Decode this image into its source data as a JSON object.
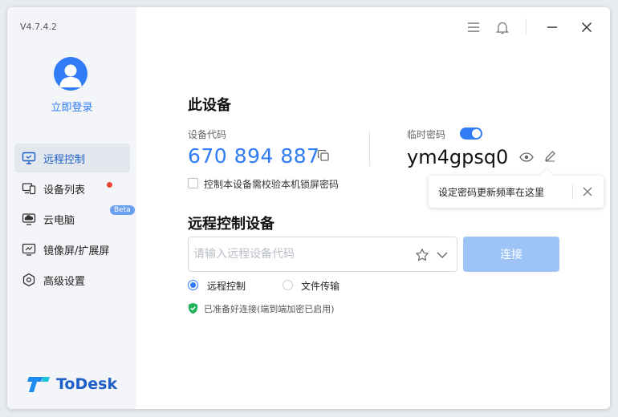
{
  "app": {
    "version": "V4.7.4.2",
    "login_label": "立即登录",
    "brand_name": "ToDesk",
    "brand_color": "#1c5fc7",
    "accent": "#2f7cf6"
  },
  "sidebar": {
    "items": [
      {
        "label": "远程控制",
        "icon": "monitor-remote-icon",
        "active": true
      },
      {
        "label": "设备列表",
        "icon": "devices-icon",
        "has_dot": true
      },
      {
        "label": "云电脑",
        "icon": "cloud-pc-icon",
        "badge": "Beta"
      },
      {
        "label": "镜像屏/扩展屏",
        "icon": "mirror-screen-icon"
      },
      {
        "label": "高级设置",
        "icon": "settings-hex-icon"
      }
    ]
  },
  "topbar": {
    "icons": [
      "menu-icon",
      "bell-icon",
      "minimize-icon",
      "close-icon"
    ]
  },
  "device": {
    "title": "此设备",
    "code_label": "设备代码",
    "code": "670 894 887",
    "temp_pwd_label": "临时密码",
    "temp_pwd_enabled": true,
    "password": "ym4gpsq0",
    "lockscreen_checkbox_label": "控制本设备需校验本机锁屏密码",
    "lockscreen_checked": false
  },
  "tooltip": {
    "text": "设定密码更新频率在这里"
  },
  "remote": {
    "title": "远程控制设备",
    "input_placeholder": "请输入远程设备代码",
    "input_value": "",
    "connect_label": "连接",
    "modes": [
      {
        "label": "远程控制",
        "selected": true
      },
      {
        "label": "文件传输",
        "selected": false
      }
    ],
    "status": "已准备好连接(端到端加密已启用)"
  }
}
